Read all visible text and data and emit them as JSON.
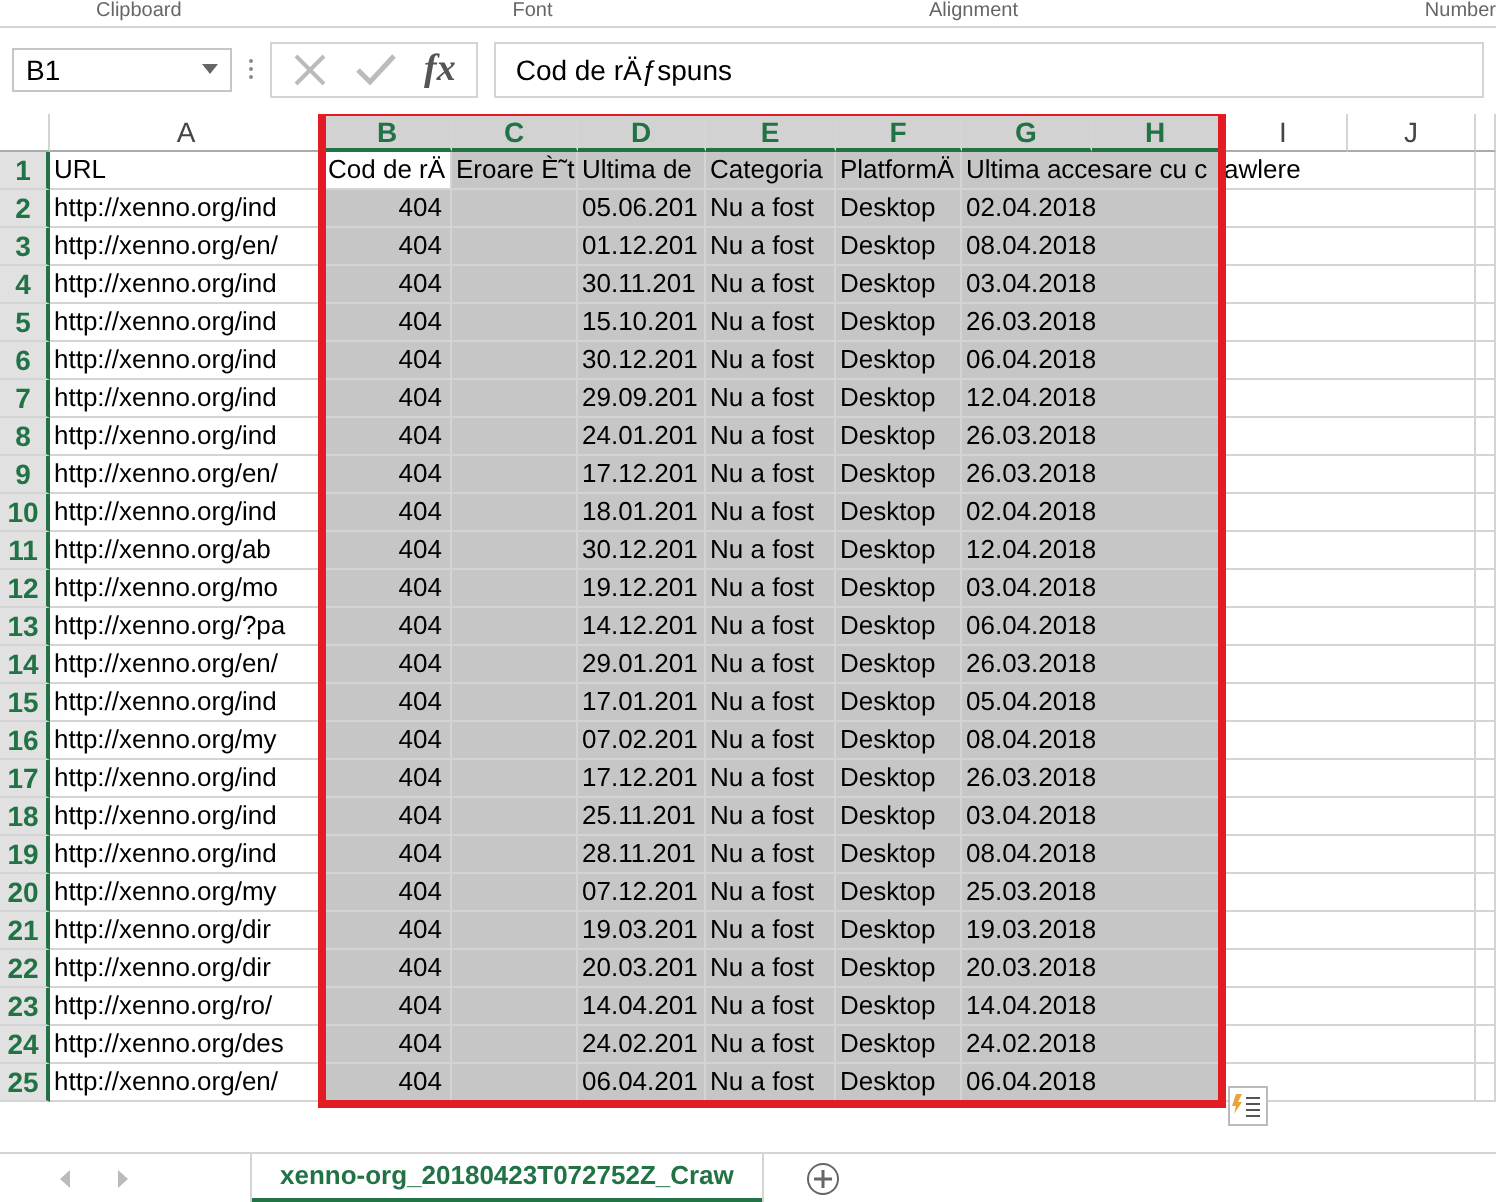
{
  "ribbon_groups": [
    "Clipboard",
    "Font",
    "Alignment",
    "Number"
  ],
  "formula_bar": {
    "name_box": "B1",
    "function_label": "fx",
    "value": "Cod de rÄƒspuns"
  },
  "table": {
    "columns": [
      {
        "label": "A",
        "selected": false
      },
      {
        "label": "B",
        "selected": true
      },
      {
        "label": "C",
        "selected": true
      },
      {
        "label": "D",
        "selected": true
      },
      {
        "label": "E",
        "selected": true
      },
      {
        "label": "F",
        "selected": true
      },
      {
        "label": "G",
        "selected": true
      },
      {
        "label": "H",
        "selected": true
      },
      {
        "label": "I",
        "selected": false
      },
      {
        "label": "J",
        "selected": false
      }
    ],
    "rows": [
      {
        "label": "1",
        "selected": true,
        "cells": [
          "URL",
          "Cod de rÄ",
          "Eroare È˜t",
          "Ultima de",
          "Categoria",
          "PlatformÄ",
          "Ultima accesare cu c",
          "",
          "awlere"
        ]
      },
      {
        "label": "2",
        "selected": true,
        "cells": [
          "http://xenno.org/ind",
          "404",
          "",
          "05.06.201",
          "Nu a fost",
          "Desktop",
          "02.04.2018",
          "",
          ""
        ]
      },
      {
        "label": "3",
        "selected": true,
        "cells": [
          "http://xenno.org/en/",
          "404",
          "",
          "01.12.201",
          "Nu a fost",
          "Desktop",
          "08.04.2018",
          "",
          ""
        ]
      },
      {
        "label": "4",
        "selected": true,
        "cells": [
          "http://xenno.org/ind",
          "404",
          "",
          "30.11.201",
          "Nu a fost",
          "Desktop",
          "03.04.2018",
          "",
          ""
        ]
      },
      {
        "label": "5",
        "selected": true,
        "cells": [
          "http://xenno.org/ind",
          "404",
          "",
          "15.10.201",
          "Nu a fost",
          "Desktop",
          "26.03.2018",
          "",
          ""
        ]
      },
      {
        "label": "6",
        "selected": true,
        "cells": [
          "http://xenno.org/ind",
          "404",
          "",
          "30.12.201",
          "Nu a fost",
          "Desktop",
          "06.04.2018",
          "",
          ""
        ]
      },
      {
        "label": "7",
        "selected": true,
        "cells": [
          "http://xenno.org/ind",
          "404",
          "",
          "29.09.201",
          "Nu a fost",
          "Desktop",
          "12.04.2018",
          "",
          ""
        ]
      },
      {
        "label": "8",
        "selected": true,
        "cells": [
          "http://xenno.org/ind",
          "404",
          "",
          "24.01.201",
          "Nu a fost",
          "Desktop",
          "26.03.2018",
          "",
          ""
        ]
      },
      {
        "label": "9",
        "selected": true,
        "cells": [
          "http://xenno.org/en/",
          "404",
          "",
          "17.12.201",
          "Nu a fost",
          "Desktop",
          "26.03.2018",
          "",
          ""
        ]
      },
      {
        "label": "10",
        "selected": true,
        "cells": [
          "http://xenno.org/ind",
          "404",
          "",
          "18.01.201",
          "Nu a fost",
          "Desktop",
          "02.04.2018",
          "",
          ""
        ]
      },
      {
        "label": "11",
        "selected": true,
        "cells": [
          "http://xenno.org/ab",
          "404",
          "",
          "30.12.201",
          "Nu a fost",
          "Desktop",
          "12.04.2018",
          "",
          ""
        ]
      },
      {
        "label": "12",
        "selected": true,
        "cells": [
          "http://xenno.org/mo",
          "404",
          "",
          "19.12.201",
          "Nu a fost",
          "Desktop",
          "03.04.2018",
          "",
          ""
        ]
      },
      {
        "label": "13",
        "selected": true,
        "cells": [
          "http://xenno.org/?pa",
          "404",
          "",
          "14.12.201",
          "Nu a fost",
          "Desktop",
          "06.04.2018",
          "",
          ""
        ]
      },
      {
        "label": "14",
        "selected": true,
        "cells": [
          "http://xenno.org/en/",
          "404",
          "",
          "29.01.201",
          "Nu a fost",
          "Desktop",
          "26.03.2018",
          "",
          ""
        ]
      },
      {
        "label": "15",
        "selected": true,
        "cells": [
          "http://xenno.org/ind",
          "404",
          "",
          "17.01.201",
          "Nu a fost",
          "Desktop",
          "05.04.2018",
          "",
          ""
        ]
      },
      {
        "label": "16",
        "selected": true,
        "cells": [
          "http://xenno.org/my",
          "404",
          "",
          "07.02.201",
          "Nu a fost",
          "Desktop",
          "08.04.2018",
          "",
          ""
        ]
      },
      {
        "label": "17",
        "selected": true,
        "cells": [
          "http://xenno.org/ind",
          "404",
          "",
          "17.12.201",
          "Nu a fost",
          "Desktop",
          "26.03.2018",
          "",
          ""
        ]
      },
      {
        "label": "18",
        "selected": true,
        "cells": [
          "http://xenno.org/ind",
          "404",
          "",
          "25.11.201",
          "Nu a fost",
          "Desktop",
          "03.04.2018",
          "",
          ""
        ]
      },
      {
        "label": "19",
        "selected": true,
        "cells": [
          "http://xenno.org/ind",
          "404",
          "",
          "28.11.201",
          "Nu a fost",
          "Desktop",
          "08.04.2018",
          "",
          ""
        ]
      },
      {
        "label": "20",
        "selected": true,
        "cells": [
          "http://xenno.org/my",
          "404",
          "",
          "07.12.201",
          "Nu a fost",
          "Desktop",
          "25.03.2018",
          "",
          ""
        ]
      },
      {
        "label": "21",
        "selected": true,
        "cells": [
          "http://xenno.org/dir",
          "404",
          "",
          "19.03.201",
          "Nu a fost",
          "Desktop",
          "19.03.2018",
          "",
          ""
        ]
      },
      {
        "label": "22",
        "selected": true,
        "cells": [
          "http://xenno.org/dir",
          "404",
          "",
          "20.03.201",
          "Nu a fost",
          "Desktop",
          "20.03.2018",
          "",
          ""
        ]
      },
      {
        "label": "23",
        "selected": true,
        "cells": [
          "http://xenno.org/ro/",
          "404",
          "",
          "14.04.201",
          "Nu a fost",
          "Desktop",
          "14.04.2018",
          "",
          ""
        ]
      },
      {
        "label": "24",
        "selected": true,
        "cells": [
          "http://xenno.org/des",
          "404",
          "",
          "24.02.201",
          "Nu a fost",
          "Desktop",
          "24.02.2018",
          "",
          ""
        ]
      },
      {
        "label": "25",
        "selected": true,
        "cells": [
          "http://xenno.org/en/",
          "404",
          "",
          "06.04.201",
          "Nu a fost",
          "Desktop",
          "06.04.2018",
          "",
          ""
        ]
      }
    ]
  },
  "sheet_tabs": [
    {
      "label": "xenno-org_20180423T072752Z_Craw",
      "selected": true
    }
  ]
}
